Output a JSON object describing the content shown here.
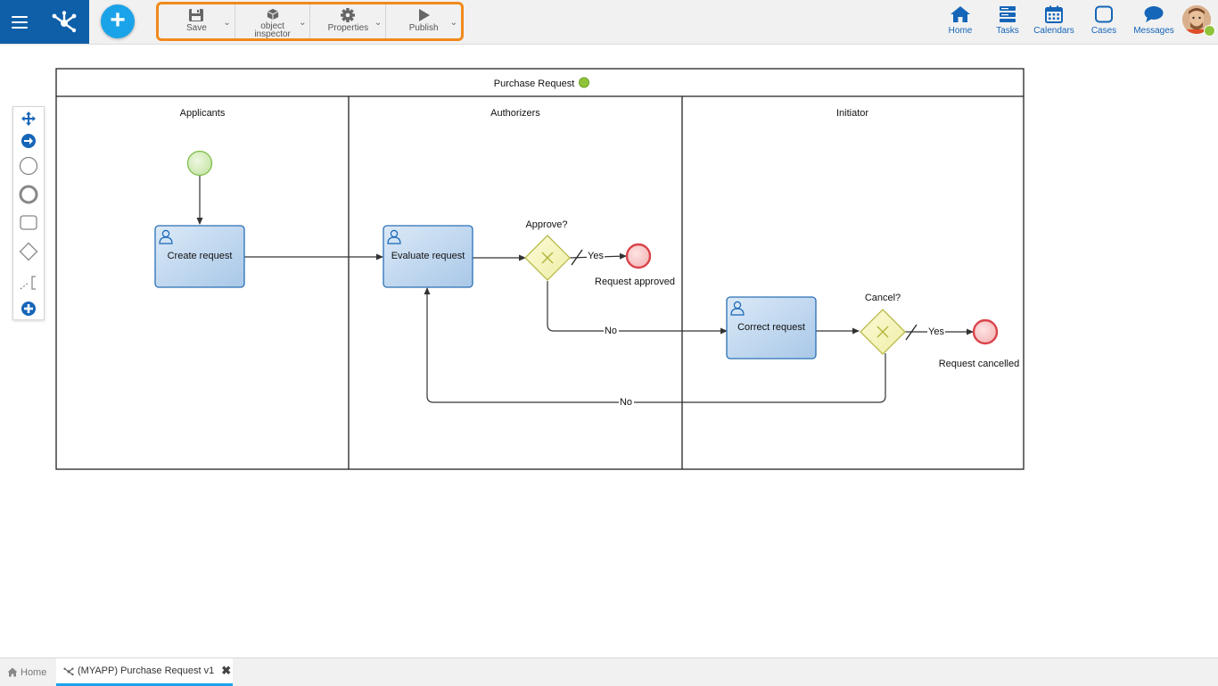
{
  "toolbar": {
    "save": "Save",
    "object_inspector_line1": "object",
    "object_inspector_line2": "inspector",
    "properties": "Properties",
    "publish": "Publish"
  },
  "nav": {
    "home": "Home",
    "tasks": "Tasks",
    "calendars": "Calendars",
    "cases": "Cases",
    "messages": "Messages"
  },
  "diagram": {
    "pool_title": "Purchase Request",
    "lanes": [
      "Applicants",
      "Authorizers",
      "Initiator"
    ],
    "tasks": {
      "create": "Create request",
      "evaluate": "Evaluate request",
      "correct": "Correct request"
    },
    "gateways": {
      "approve": "Approve?",
      "cancel": "Cancel?"
    },
    "flow_labels": {
      "yes_approve": "Yes",
      "no_approve": "No",
      "yes_cancel": "Yes",
      "no_cancel": "No"
    },
    "end_events": {
      "approved": "Request approved",
      "cancelled": "Request cancelled"
    }
  },
  "bottom_tabs": {
    "home": "Home",
    "active": "(MYAPP) Purchase Request v1"
  },
  "colors": {
    "brand_blue": "#0f5fa8",
    "accent_cyan": "#1aa3e8",
    "toolbar_highlight": "#f08a1c",
    "status_green": "#8fc43a"
  }
}
